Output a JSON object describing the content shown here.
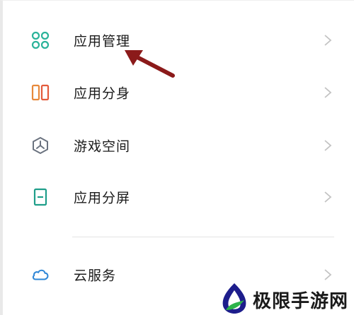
{
  "menu": {
    "items": [
      {
        "label": "应用管理",
        "icon": "app-grid-icon"
      },
      {
        "label": "应用分身",
        "icon": "app-clone-icon"
      },
      {
        "label": "游戏空间",
        "icon": "game-space-icon"
      },
      {
        "label": "应用分屏",
        "icon": "split-screen-icon"
      },
      {
        "label": "云服务",
        "icon": "cloud-icon"
      }
    ]
  },
  "annotation": {
    "icon": "red-arrow-icon"
  },
  "watermark": {
    "text": "极限手游网",
    "icon": "watermark-logo-icon"
  },
  "colors": {
    "grid_icon": "#2bb39a",
    "clone_icon_left": "#e7883a",
    "clone_icon_right": "#e45a3b",
    "game_icon": "#6b7380",
    "split_icon": "#1f9e8a",
    "cloud_icon": "#2e86d6",
    "chevron": "#c3c3c3",
    "arrow": "#8b1a1a"
  }
}
